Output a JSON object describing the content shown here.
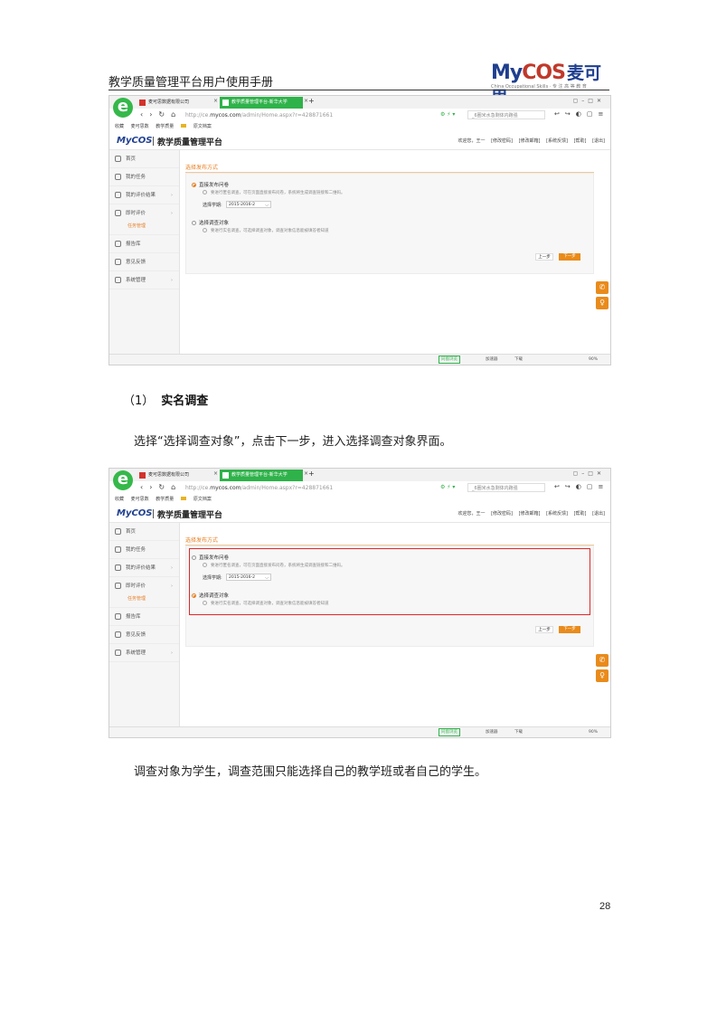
{
  "header": {
    "doc_title": "教学质量管理平台用户使用手册",
    "logo_text_my": "My",
    "logo_text_cos": "COS",
    "logo_cn": "麦可思",
    "logo_sub": "China Occupational Skills · 专 注 高 等 教 育"
  },
  "browser": {
    "tab1_label": "麦可思数据有限公司",
    "tab2_label": "教学质量管理平台-新华大学",
    "url_prefix": "http://ce.",
    "url_domain": "mycos.com",
    "url_path": "/admin/Home.aspx?r=428871661",
    "search_text": "_6圈米水急剩体内跑强",
    "fav_items": [
      "收藏",
      "麦可思数",
      "教学质量",
      "原文档案"
    ],
    "status_items": [
      "同窗浏览",
      "加速器",
      "下载",
      "90%"
    ]
  },
  "app": {
    "logo": "MyCOS",
    "title": "教学质量管理平台",
    "user_links": [
      "欢迎您，王一",
      "[修改密码]",
      "[修改邮箱]",
      "[系统反馈]",
      "[帮助]",
      "[退出]"
    ],
    "sidebar": [
      {
        "label": "首页",
        "arrow": ""
      },
      {
        "label": "我的任务",
        "arrow": ""
      },
      {
        "label": "我的评价结果",
        "arrow": "›"
      },
      {
        "label": "即时评价",
        "arrow": "›"
      },
      {
        "label": "报告库",
        "arrow": ""
      },
      {
        "label": "意见反馈",
        "arrow": ""
      },
      {
        "label": "系统管理",
        "arrow": "›"
      }
    ],
    "sidebar_sub": "任务管理",
    "section_title": "选择发布方式",
    "option1_label": "直接发布问卷",
    "option1_hint": "要进行匿名调查，可在页面直接发布问卷，系统将生成调查链接和二维码。",
    "semester_label": "选择学期:",
    "semester_value": "2015-2016-2",
    "option2_label": "选择调查对象",
    "option2_hint": "要进行实名调查，可选择调查对象，调查对象信息能被填答者知道",
    "btn_prev": "上一步",
    "btn_next": "下一步"
  },
  "body": {
    "heading_num": "（1）",
    "heading_text": "实名调查",
    "para1": "选择“选择调查对象”，点击下一步，进入选择调查对象界面。",
    "para2": "调查对象为学生，调查范围只能选择自己的教学班或者自己的学生。",
    "page_number": "28"
  }
}
